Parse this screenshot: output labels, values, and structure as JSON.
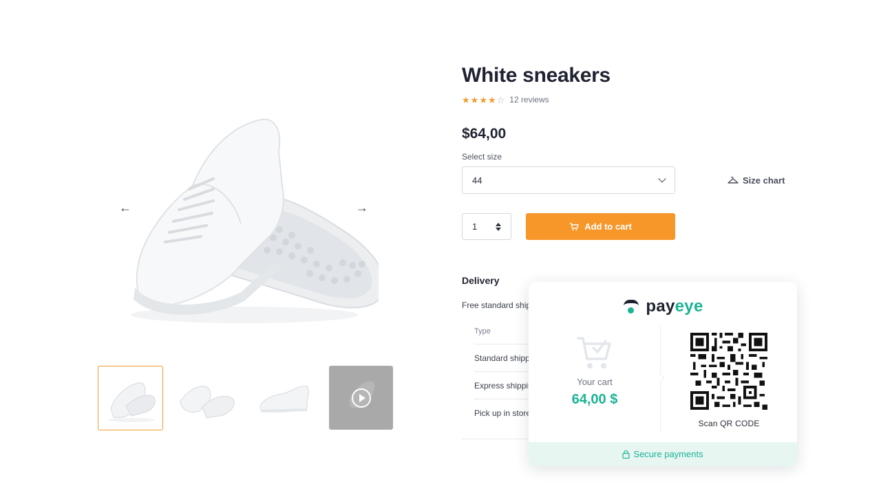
{
  "product": {
    "title": "White sneakers",
    "rating": {
      "value": 4,
      "max": 5,
      "reviews_label": "12 reviews"
    },
    "price": "$64,00",
    "size": {
      "label": "Select size",
      "selected": "44",
      "size_chart_label": "Size chart"
    },
    "quantity": "1",
    "add_to_cart_label": "Add to cart"
  },
  "gallery": {
    "prev_arrow": "←",
    "next_arrow": "→",
    "thumbnails": [
      "thumbnail-1",
      "thumbnail-2",
      "thumbnail-3",
      "video-thumbnail"
    ],
    "active_thumbnail": 0
  },
  "delivery": {
    "title": "Delivery",
    "text": "Free standard ship",
    "table": {
      "header": "Type",
      "rows": [
        "Standard shipp",
        "Express shippin",
        "Pick up in store"
      ]
    }
  },
  "payeye": {
    "brand_pay": "pay",
    "brand_eye": "eye",
    "your_cart_label": "Your cart",
    "cart_total": "64,00 $",
    "scan_label": "Scan QR CODE",
    "secure_label": "Secure payments"
  },
  "colors": {
    "accent_orange": "#f7972a",
    "payeye_green": "#1bb394",
    "text_dark": "#1f2230"
  }
}
